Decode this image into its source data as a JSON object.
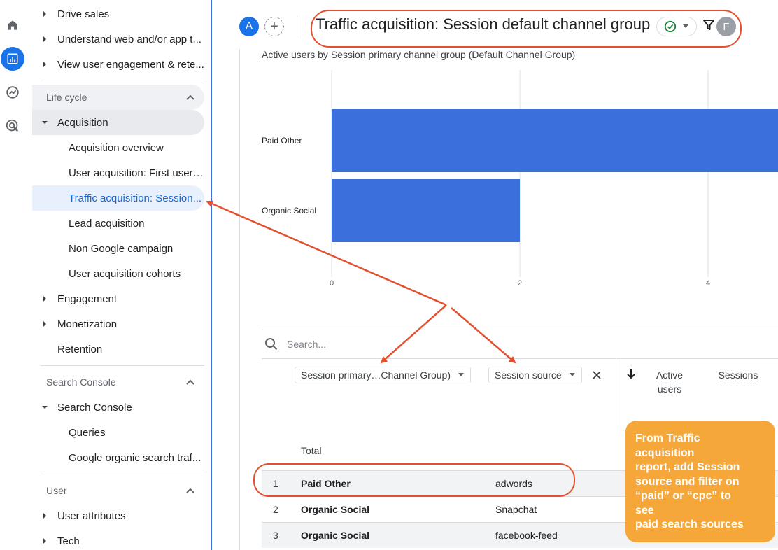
{
  "colors": {
    "accent": "#1a73e8",
    "bar": "#3b6fdb",
    "annotation": "#e4502f",
    "callout": "#f5a73a"
  },
  "rail": {
    "icons": [
      "home-icon",
      "reports-icon",
      "explore-icon",
      "advertising-icon"
    ]
  },
  "nav": {
    "top_items": [
      "Drive sales",
      "Understand web and/or app t...",
      "View user engagement & rete..."
    ],
    "lifecycle": {
      "label": "Life cycle",
      "acquisition": "Acquisition",
      "acq_children": [
        "Acquisition overview",
        "User acquisition: First user ...",
        "Traffic acquisition: Session...",
        "Lead acquisition",
        "Non Google campaign",
        "User acquisition cohorts"
      ],
      "engagement": "Engagement",
      "monetization": "Monetization",
      "retention": "Retention"
    },
    "search_console": {
      "label": "Search Console",
      "group": "Search Console",
      "children": [
        "Queries",
        "Google organic search traf..."
      ]
    },
    "user": {
      "label": "User",
      "items": [
        "User attributes",
        "Tech"
      ]
    }
  },
  "header": {
    "avatar_a": "A",
    "add": "+",
    "title": "Traffic acquisition: Session default channel group",
    "avatar_f": "F"
  },
  "chart_data": {
    "type": "bar",
    "orientation": "horizontal",
    "title": "Active users by Session primary channel group (Default Channel Group)",
    "categories": [
      "Paid Other",
      "Organic Social"
    ],
    "values": [
      5,
      2
    ],
    "xticks": [
      "0",
      "2",
      "4"
    ],
    "xlim": [
      0,
      5.5
    ],
    "grid": true
  },
  "table": {
    "search_placeholder": "Search...",
    "dim1": "Session primary…Channel Group)",
    "dim2": "Session source",
    "metric1_line1": "Active",
    "metric1_line2": "users",
    "metric2": "Sessions",
    "total_label": "Total",
    "rows": [
      {
        "num": "1",
        "channel": "Paid Other",
        "source": "adwords"
      },
      {
        "num": "2",
        "channel": "Organic Social",
        "source": "Snapchat"
      },
      {
        "num": "3",
        "channel": "Organic Social",
        "source": "facebook-feed"
      }
    ]
  },
  "callout": {
    "text": "From Traffic\nacquisition\n report, add Session\nsource and filter on\n“paid” or “cpc” to\nsee\npaid search sources"
  }
}
